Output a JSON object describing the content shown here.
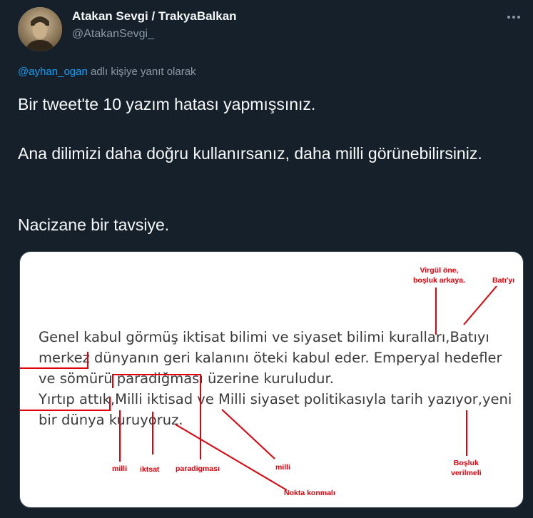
{
  "author": {
    "display_name": "Atakan Sevgi / TrakyaBalkan",
    "handle": "@AtakanSevgi_"
  },
  "reply": {
    "mention": "@ayhan_ogan",
    "suffix": " adlı kişiye yanıt olarak"
  },
  "tweet": {
    "line1": "Bir tweet'te 10 yazım hatası yapmışsınız.",
    "line2": "Ana dilimizi daha doğru kullanırsanız, daha milli görünebilirsiniz.",
    "line3": "Nacizane bir tavsiye."
  },
  "media": {
    "doc_lines": [
      "Genel kabul görmüş iktisat bilimi ve siyaset bilimi kuralları,Batıyı",
      "merkez dünyanın geri kalanını öteki kabul eder. Emperyal hedefler",
      "ve sömürü paradiğması üzerine kuruludur.",
      "Yırtıp attık,Milli iktisad ve Milli siyaset politikasıyla tarih yazıyor,yeni",
      "bir dünya kuruyoruz."
    ],
    "notes": {
      "virgul": "Virgül öne,\nboşluk arkaya.",
      "bati": "Batı'yı",
      "milli1": "milli",
      "iktisat": "iktsat",
      "paradigmasi": "paradigması",
      "milli2": "milli",
      "bosluk": "Boşluk\nverilmeli",
      "nokta": "Nokta konmalı"
    },
    "annotation_color": "#e1000b"
  },
  "colors": {
    "background": "#15202b",
    "primary_text": "#f7f9f9",
    "secondary_text": "#8b98a5",
    "link": "#1d9bf0"
  },
  "icons": {
    "more": "more-horizontal-icon"
  }
}
